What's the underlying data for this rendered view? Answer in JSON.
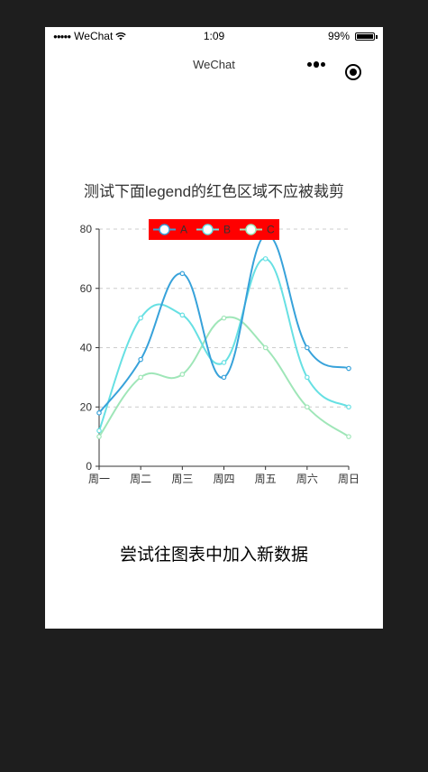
{
  "status_bar": {
    "carrier": "WeChat",
    "time": "1:09",
    "battery": "99%",
    "battery_level": 0.99
  },
  "nav": {
    "title": "WeChat",
    "more_icon": "more-dots-icon",
    "close_icon": "target-close-icon"
  },
  "chart_title": "测试下面legend的红色区域不应被裁剪",
  "bottom_text": "尝试往图表中加入新数据",
  "chart_data": {
    "type": "line",
    "smooth": true,
    "categories": [
      "周一",
      "周二",
      "周三",
      "周四",
      "周五",
      "周六",
      "周日"
    ],
    "series": [
      {
        "name": "A",
        "values": [
          18,
          36,
          65,
          30,
          78,
          40,
          33
        ],
        "color": "#37a2da"
      },
      {
        "name": "B",
        "values": [
          12,
          50,
          51,
          35,
          70,
          30,
          20
        ],
        "color": "#67e0e3"
      },
      {
        "name": "C",
        "values": [
          10,
          30,
          31,
          50,
          40,
          20,
          10
        ],
        "color": "#9fe6b8"
      }
    ],
    "ylim": [
      0,
      80
    ],
    "yticks": [
      0,
      20,
      40,
      60,
      80
    ],
    "grid": "dashed horizontal",
    "legend": {
      "placement": "top-center",
      "background": "#ff0000"
    }
  }
}
